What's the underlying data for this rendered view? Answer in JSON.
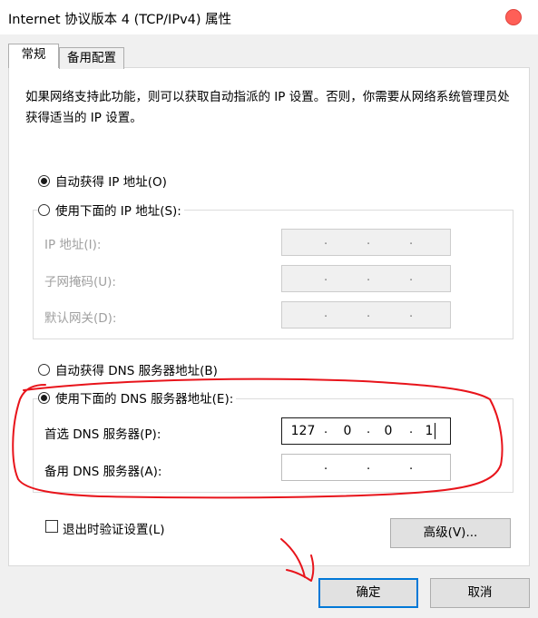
{
  "window": {
    "title": "Internet 协议版本 4 (TCP/IPv4) 属性"
  },
  "tabs": [
    "常规",
    "备用配置"
  ],
  "description": "如果网络支持此功能，则可以获取自动指派的 IP 设置。否则，你需要从网络系统管理员处获得适当的 IP 设置。",
  "ip_section": {
    "auto_label": "自动获得 IP 地址(O)",
    "auto_selected": true,
    "manual_label": "使用下面的 IP 地址(S):",
    "manual_selected": false,
    "fields": [
      {
        "label": "IP 地址(I):",
        "octets": [
          "",
          "",
          "",
          ""
        ]
      },
      {
        "label": "子网掩码(U):",
        "octets": [
          "",
          "",
          "",
          ""
        ]
      },
      {
        "label": "默认网关(D):",
        "octets": [
          "",
          "",
          "",
          ""
        ]
      }
    ]
  },
  "dns_section": {
    "auto_label": "自动获得 DNS 服务器地址(B)",
    "auto_selected": false,
    "manual_label": "使用下面的 DNS 服务器地址(E):",
    "manual_selected": true,
    "preferred_label": "首选 DNS 服务器(P):",
    "preferred_octets": [
      "127",
      "0",
      "0",
      "1"
    ],
    "alternate_label": "备用 DNS 服务器(A):",
    "alternate_octets": [
      "",
      "",
      "",
      ""
    ]
  },
  "validate_on_exit": {
    "label": "退出时验证设置(L)",
    "checked": false
  },
  "buttons": {
    "advanced": "高级(V)...",
    "ok": "确定",
    "cancel": "取消"
  },
  "colors": {
    "annotation": "#e8141b",
    "focus": "#0078d7",
    "close": "#ff5f57"
  }
}
